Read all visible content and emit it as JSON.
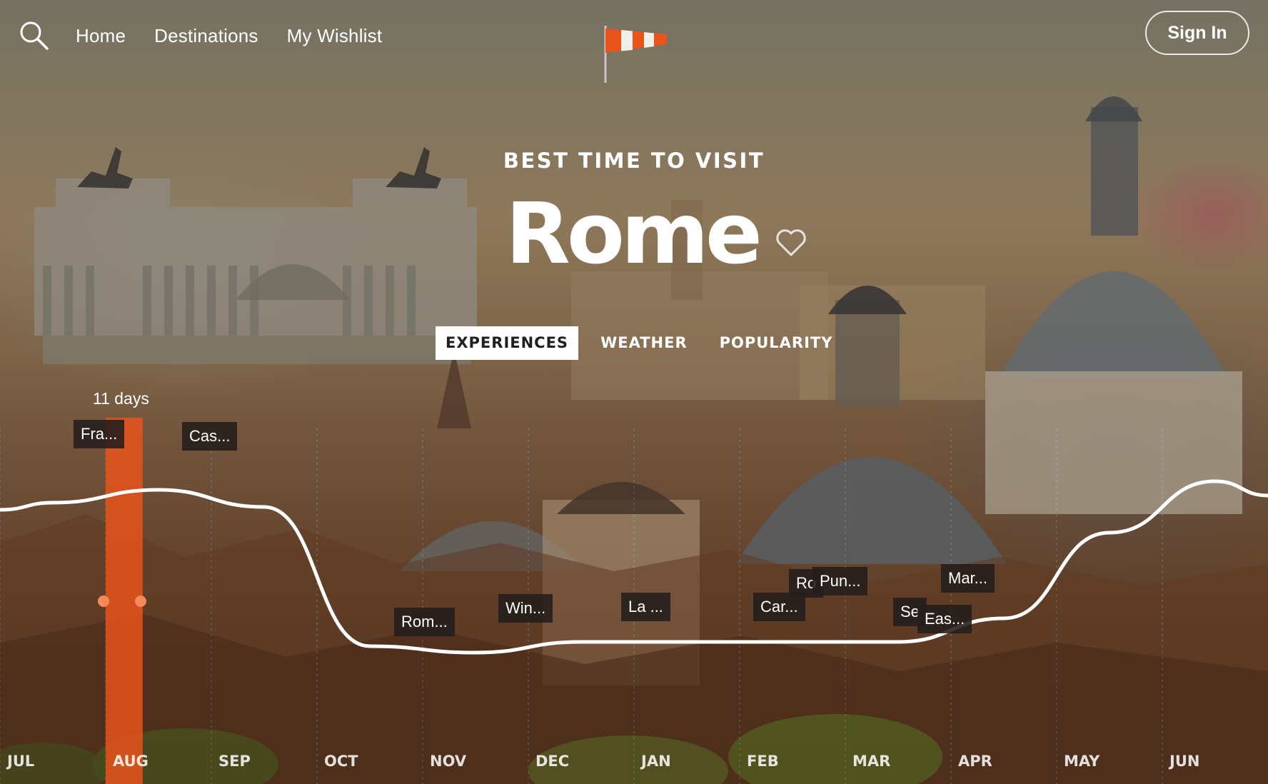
{
  "nav": {
    "links": [
      "Home",
      "Destinations",
      "My Wishlist"
    ],
    "signin": "Sign In"
  },
  "hero": {
    "subtitle": "BEST TIME TO VISIT",
    "city": "Rome"
  },
  "tabs": [
    "EXPERIENCES",
    "WEATHER",
    "POPULARITY"
  ],
  "active_tab": "EXPERIENCES",
  "selection": {
    "label": "11 days",
    "month": "AUG"
  },
  "colors": {
    "accent": "#e8541c",
    "line": "#ffffff",
    "tag_bg": "#231e1c"
  },
  "chart_data": {
    "type": "line",
    "x": [
      "JUL",
      "AUG",
      "SEP",
      "OCT",
      "NOV",
      "DEC",
      "JAN",
      "FEB",
      "MAR",
      "APR",
      "MAY",
      "JUN"
    ],
    "series": [
      {
        "values": [
          0.72,
          0.78,
          0.7,
          0.05,
          0.02,
          0.07,
          0.07,
          0.07,
          0.07,
          0.18,
          0.58,
          0.82
        ]
      }
    ],
    "events": [
      "Fra...",
      "Cas...",
      "Rom...",
      "Win...",
      "La ...",
      "Car...",
      "Ro",
      "Pun...",
      "Se",
      "Eas...",
      "Mar..."
    ]
  }
}
